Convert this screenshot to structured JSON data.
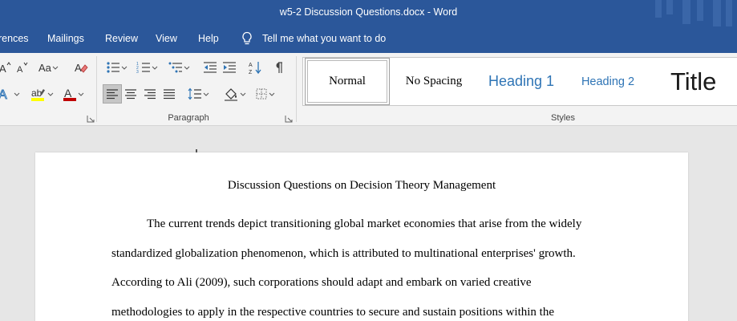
{
  "window": {
    "title": "w5-2 Discussion Questions.docx  -  Word"
  },
  "menu": {
    "items": [
      "rences",
      "Mailings",
      "Review",
      "View",
      "Help"
    ],
    "tell_me": "Tell me what you want to do"
  },
  "ribbon": {
    "groups": {
      "paragraph": "Paragraph",
      "styles": "Styles"
    },
    "font_buttons": {
      "change_case": "Aa"
    },
    "styles": [
      "Normal",
      "No Spacing",
      "Heading 1",
      "Heading 2",
      "Title"
    ]
  },
  "colors": {
    "titlebar": "#2b579a",
    "highlight": "#ffff00",
    "font_color": "#c00000",
    "heading_blue": "#2e74b5"
  },
  "document": {
    "title": "Discussion Questions on Decision Theory Management",
    "lines": [
      "The current trends depict transitioning global market economies that arise from the widely",
      "standardized globalization phenomenon, which is attributed to multinational enterprises' growth.",
      "According to Ali (2009), such corporations should adapt and embark on varied creative",
      "methodologies to apply in the respective countries to secure and sustain positions within the"
    ]
  }
}
